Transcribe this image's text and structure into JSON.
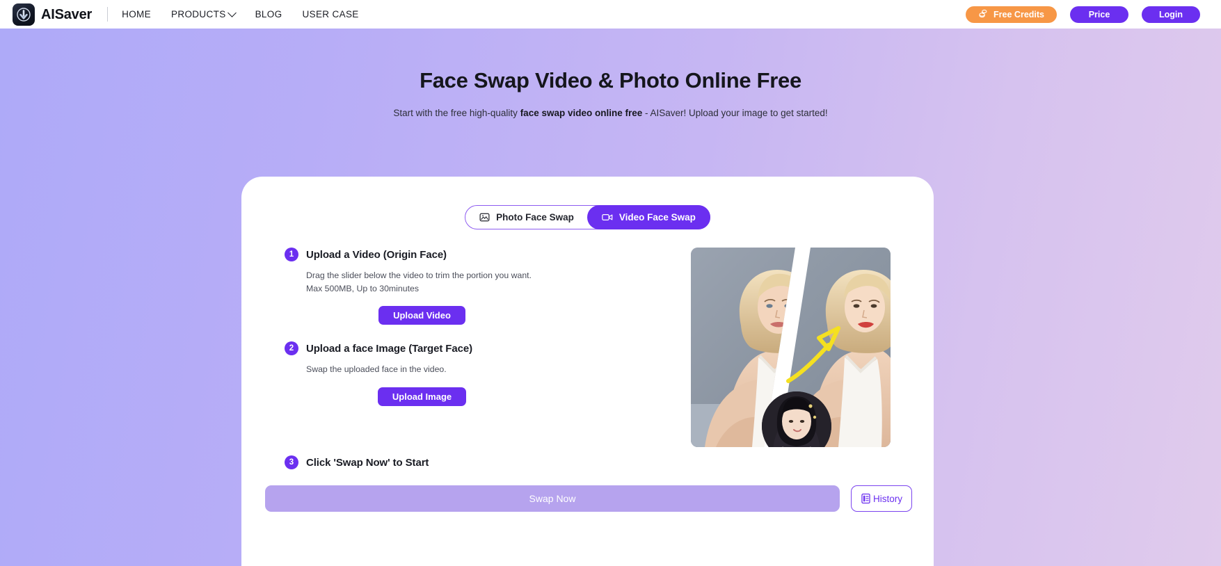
{
  "header": {
    "logo_icon": "download-arrow-logo-icon",
    "brand": "AISaver",
    "nav": [
      {
        "label": "HOME",
        "has_caret": false
      },
      {
        "label": "PRODUCTS",
        "has_caret": true
      },
      {
        "label": "BLOG",
        "has_caret": false
      },
      {
        "label": "USER CASE",
        "has_caret": false
      }
    ],
    "free_credits": {
      "label": "Free Credits",
      "icon": "coins-icon",
      "color": "#f79746"
    },
    "price_label": "Price",
    "login_label": "Login",
    "accent": "#6b2ff0"
  },
  "hero": {
    "title": "Face Swap Video & Photo Online Free",
    "subtitle_pre": "Start with the free high-quality ",
    "subtitle_bold": "face swap video online free",
    "subtitle_post": " - AISaver! Upload your image to get started!",
    "gradient_from": "#aeaaf8",
    "gradient_to": "#e0cbec"
  },
  "tabs": [
    {
      "label": "Photo Face Swap",
      "icon": "image-icon",
      "active": false
    },
    {
      "label": "Video Face Swap",
      "icon": "video-camera-icon",
      "active": true
    }
  ],
  "steps": [
    {
      "num": "1",
      "title": "Upload a Video (Origin Face)",
      "desc_line1": "Drag the slider below the video to trim the portion you want.",
      "desc_line2": "Max 500MB, Up to 30minutes",
      "button": "Upload Video"
    },
    {
      "num": "2",
      "title": "Upload a face Image (Target Face)",
      "desc_line1": "Swap the uploaded face in the video.",
      "desc_line2": "",
      "button": "Upload Image"
    },
    {
      "num": "3",
      "title": "Click 'Swap Now' to Start",
      "desc_line1": "",
      "desc_line2": "",
      "button": ""
    }
  ],
  "preview": {
    "alt": "before-and-after face swap comparison of a blonde woman, with an inset circular target face photo and a yellow arrow",
    "inset_alt": "target-face-thumbnail"
  },
  "cta": {
    "swap_label": "Swap Now",
    "swap_disabled": true,
    "history_label": "History",
    "history_icon": "document-list-icon"
  }
}
